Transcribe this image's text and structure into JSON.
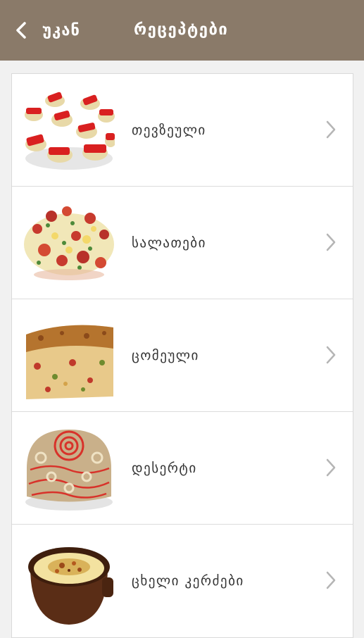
{
  "header": {
    "back_label": "უკან",
    "title": "რეცეპტები",
    "background": "#8a7a69"
  },
  "categories": [
    {
      "label": "თევზეული",
      "thumb": "canape-plate"
    },
    {
      "label": "სალათები",
      "thumb": "salad-plate"
    },
    {
      "label": "ცომეული",
      "thumb": "pie-slice"
    },
    {
      "label": "დესერტი",
      "thumb": "dessert-cake"
    },
    {
      "label": "ცხელი კერძები",
      "thumb": "clay-pot-dish"
    }
  ],
  "icons": {
    "back": "chevron-left-icon",
    "row": "chevron-right-icon"
  }
}
